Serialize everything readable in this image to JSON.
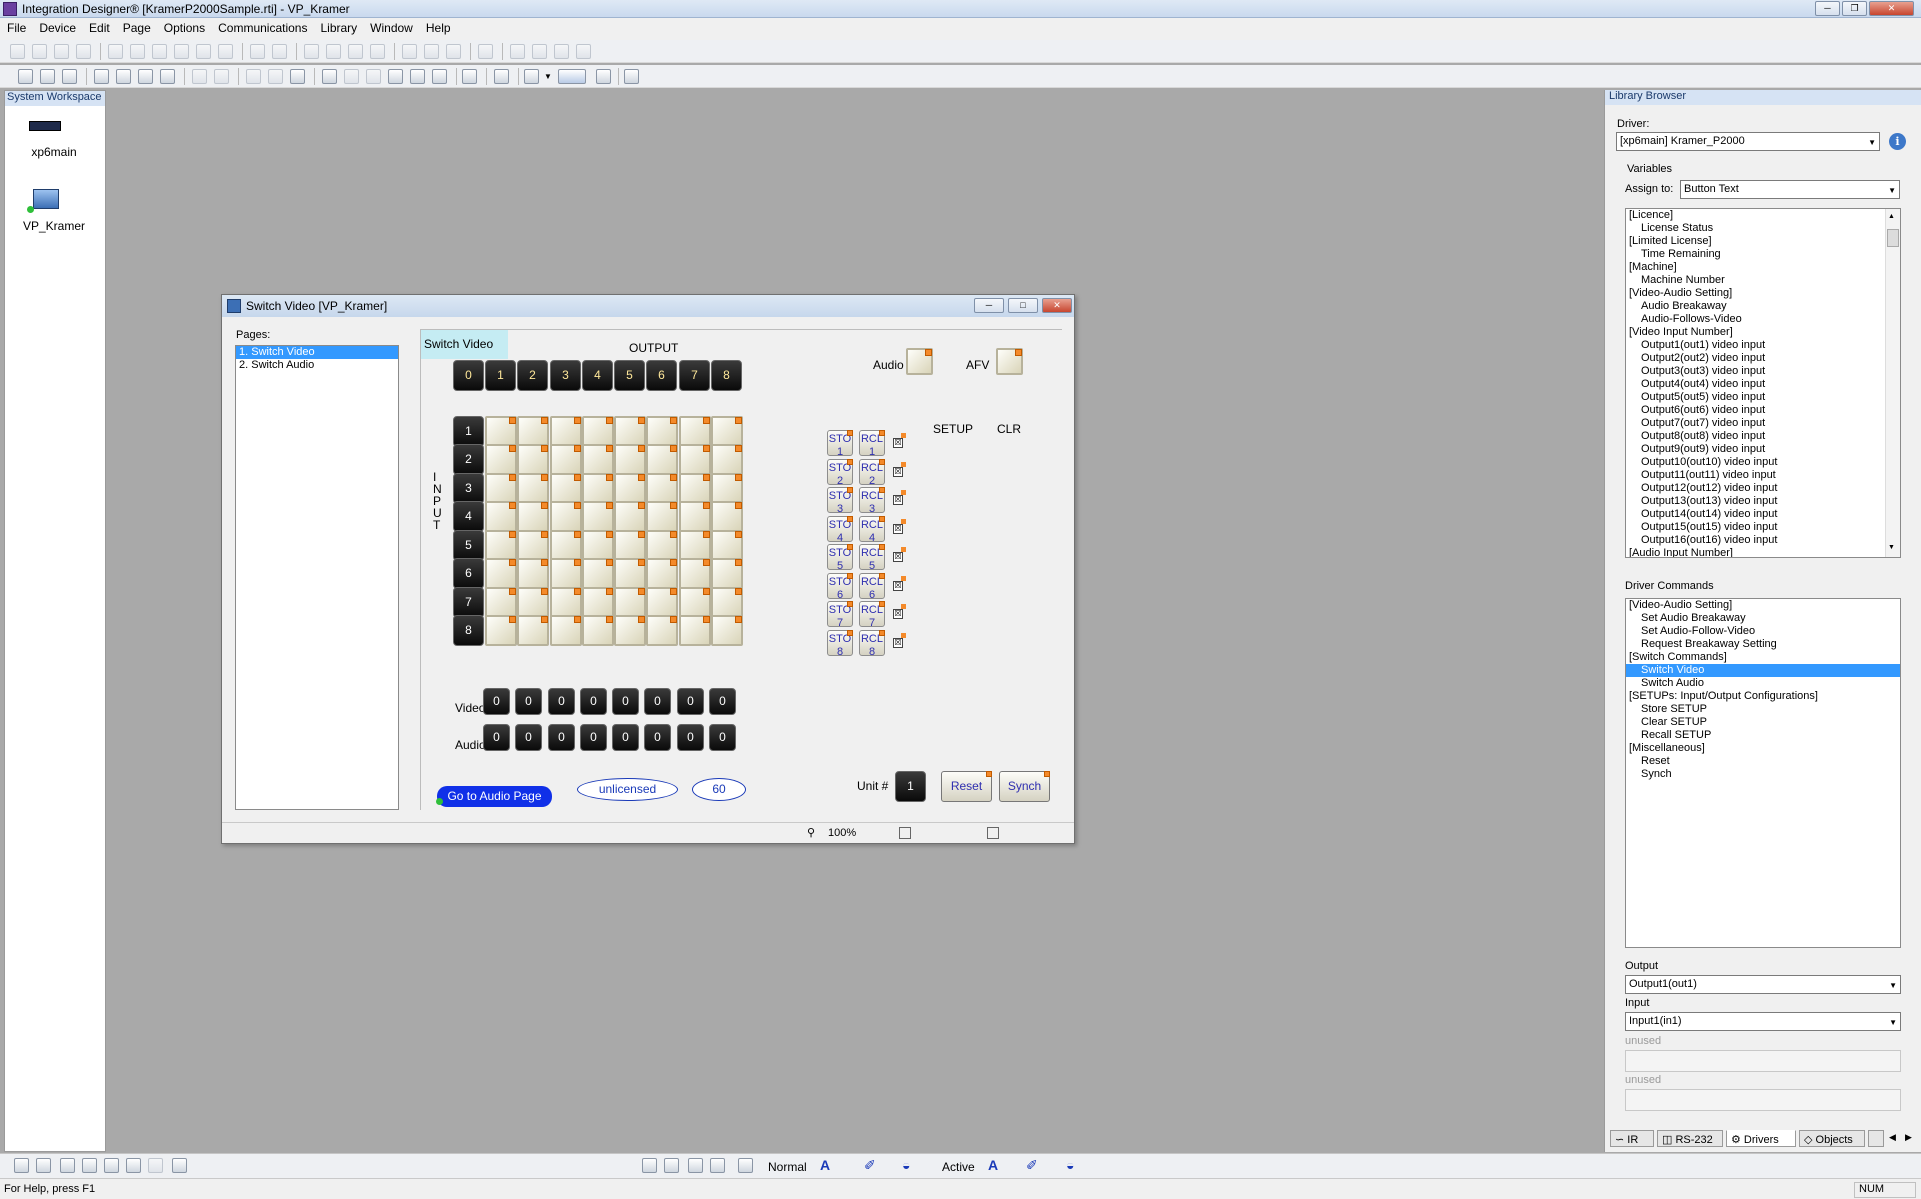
{
  "app": {
    "title": "Integration Designer® [KramerP2000Sample.rti] - VP_Kramer"
  },
  "menu": [
    "File",
    "Device",
    "Edit",
    "Page",
    "Options",
    "Communications",
    "Library",
    "Window",
    "Help"
  ],
  "workspace": {
    "title": "System Workspace",
    "items": [
      {
        "label": "xp6main",
        "icon": "processor-icon"
      },
      {
        "label": "VP_Kramer",
        "icon": "computer-icon"
      }
    ]
  },
  "window": {
    "title": "Switch Video [VP_Kramer]",
    "pages_label": "Pages:",
    "pages": [
      "1. Switch Video",
      "2. Switch Audio"
    ],
    "selected_page": 0,
    "page_name_tab": "Switch Video",
    "output_label": "OUTPUT",
    "input_label": [
      "I",
      "N",
      "P",
      "U",
      "T"
    ],
    "output_buttons": [
      "0",
      "1",
      "2",
      "3",
      "4",
      "5",
      "6",
      "7",
      "8"
    ],
    "input_buttons": [
      "1",
      "2",
      "3",
      "4",
      "5",
      "6",
      "7",
      "8"
    ],
    "grid": {
      "rows": 8,
      "cols": 8
    },
    "video_label": "Video",
    "audio_label": "Audio",
    "video_values": [
      "0",
      "0",
      "0",
      "0",
      "0",
      "0",
      "0",
      "0"
    ],
    "audio_values": [
      "0",
      "0",
      "0",
      "0",
      "0",
      "0",
      "0",
      "0"
    ],
    "audio_toggle_label": "Audio",
    "afv_label": "AFV",
    "setup_label": "SETUP",
    "clr_label": "CLR",
    "setups": [
      {
        "sto": "STO",
        "rcl": "RCL",
        "n": "1"
      },
      {
        "sto": "STO",
        "rcl": "RCL",
        "n": "2"
      },
      {
        "sto": "STO",
        "rcl": "RCL",
        "n": "3"
      },
      {
        "sto": "STO",
        "rcl": "RCL",
        "n": "4"
      },
      {
        "sto": "STO",
        "rcl": "RCL",
        "n": "5"
      },
      {
        "sto": "STO",
        "rcl": "RCL",
        "n": "6"
      },
      {
        "sto": "STO",
        "rcl": "RCL",
        "n": "7"
      },
      {
        "sto": "STO",
        "rcl": "RCL",
        "n": "8"
      }
    ],
    "goto_label": "Go to Audio Page",
    "unlicensed": "unlicensed",
    "time_remaining": "60",
    "unit_label": "Unit #",
    "unit_value": "1",
    "reset_label": "Reset",
    "synch_label": "Synch",
    "zoom": "100%"
  },
  "library": {
    "title": "Library Browser",
    "driver_label": "Driver:",
    "driver_value": "[xp6main] Kramer_P2000",
    "variables_label": "Variables",
    "assign_label": "Assign to:",
    "assign_value": "Button Text",
    "variables": [
      {
        "t": "[Licence]",
        "i": false
      },
      {
        "t": "License Status",
        "i": true
      },
      {
        "t": "[Limited License]",
        "i": false
      },
      {
        "t": "Time Remaining",
        "i": true
      },
      {
        "t": "[Machine]",
        "i": false
      },
      {
        "t": "Machine Number",
        "i": true
      },
      {
        "t": "[Video-Audio Setting]",
        "i": false
      },
      {
        "t": "Audio Breakaway",
        "i": true
      },
      {
        "t": "Audio-Follows-Video",
        "i": true
      },
      {
        "t": "[Video Input Number]",
        "i": false
      },
      {
        "t": "Output1(out1) video input",
        "i": true
      },
      {
        "t": "Output2(out2) video input",
        "i": true
      },
      {
        "t": "Output3(out3) video input",
        "i": true
      },
      {
        "t": "Output4(out4) video input",
        "i": true
      },
      {
        "t": "Output5(out5) video input",
        "i": true
      },
      {
        "t": "Output6(out6) video input",
        "i": true
      },
      {
        "t": "Output7(out7) video input",
        "i": true
      },
      {
        "t": "Output8(out8) video input",
        "i": true
      },
      {
        "t": "Output9(out9) video input",
        "i": true
      },
      {
        "t": "Output10(out10) video input",
        "i": true
      },
      {
        "t": "Output11(out11) video input",
        "i": true
      },
      {
        "t": "Output12(out12) video input",
        "i": true
      },
      {
        "t": "Output13(out13) video input",
        "i": true
      },
      {
        "t": "Output14(out14) video input",
        "i": true
      },
      {
        "t": "Output15(out15) video input",
        "i": true
      },
      {
        "t": "Output16(out16) video input",
        "i": true
      },
      {
        "t": "[Audio Input Number]",
        "i": false
      }
    ],
    "commands_label": "Driver Commands",
    "commands": [
      {
        "t": "[Video-Audio Setting]",
        "i": false
      },
      {
        "t": "Set Audio Breakaway",
        "i": true
      },
      {
        "t": "Set Audio-Follow-Video",
        "i": true
      },
      {
        "t": "Request Breakaway Setting",
        "i": true
      },
      {
        "t": "[Switch Commands]",
        "i": false
      },
      {
        "t": "Switch Video",
        "i": true,
        "sel": true
      },
      {
        "t": "Switch Audio",
        "i": true
      },
      {
        "t": "[SETUPs: Input/Output Configurations]",
        "i": false
      },
      {
        "t": "Store SETUP",
        "i": true
      },
      {
        "t": "Clear SETUP",
        "i": true
      },
      {
        "t": "Recall SETUP",
        "i": true
      },
      {
        "t": "[Miscellaneous]",
        "i": false
      },
      {
        "t": "Reset",
        "i": true
      },
      {
        "t": "Synch",
        "i": true
      }
    ],
    "output_label": "Output",
    "output_value": "Output1(out1)",
    "input_label": "Input",
    "input_value": "Input1(in1)",
    "unused1": "unused",
    "unused2": "unused",
    "tabs": [
      "IR",
      "RS-232",
      "Drivers",
      "Objects"
    ],
    "active_tab": "Drivers"
  },
  "bottom_toolbar": {
    "line_style": "Normal",
    "state": "Active"
  },
  "status": {
    "help": "For Help, press F1",
    "num": "NUM"
  }
}
